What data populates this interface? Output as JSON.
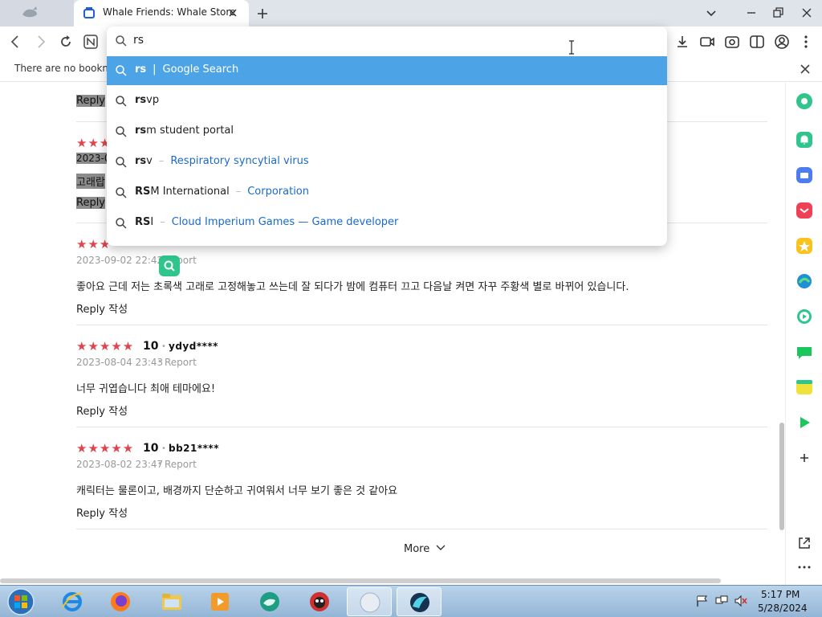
{
  "browser": {
    "tab_title": "Whale Friends: Whale Store",
    "bookmark_bar_text": "There are no bookma",
    "omnibox_query": "rs",
    "suggestions": [
      {
        "match": "rs",
        "rest": "",
        "sep": "|",
        "desc": "Google Search",
        "selected": true
      },
      {
        "match": "rs",
        "rest": "vp",
        "sep": "",
        "desc": "",
        "selected": false
      },
      {
        "match": "rs",
        "rest": "m student portal",
        "sep": "",
        "desc": "",
        "selected": false
      },
      {
        "match": "rs",
        "rest": "v",
        "sep": "–",
        "desc": "Respiratory syncytial virus",
        "selected": false
      },
      {
        "match": "RS",
        "rest": "M International",
        "sep": "–",
        "desc": "Corporation",
        "selected": false
      },
      {
        "match": "RS",
        "rest": "I",
        "sep": "–",
        "desc": "Cloud Imperium Games — Game developer",
        "selected": false
      }
    ]
  },
  "page": {
    "partial_review_1": {
      "reply": "Reply"
    },
    "partial_review_2": {
      "stars": "★★★",
      "date": "2023-0",
      "body": "고래랍",
      "reply": "Reply"
    },
    "partial_review_3": {
      "stars": "★★★",
      "date": "2023-09-02 22:42",
      "report": "Report",
      "body": "좋아요 근데 저는 초록색 고래로 고정해놓고 쓰는데 잘 되다가 밤에 컴퓨터 끄고 다음날 켜면 자꾸 주황색 별로 바뀌어 있습니다.",
      "reply": "Reply 작성"
    },
    "reviews": [
      {
        "stars": "★★★★★",
        "score": "10",
        "user": "ydyd****",
        "date": "2023-08-04 23:43",
        "report": "Report",
        "body": "너무 귀엽습니다 최애 테마에요!",
        "reply": "Reply 작성"
      },
      {
        "stars": "★★★★★",
        "score": "10",
        "user": "bb21****",
        "date": "2023-08-02 23:47",
        "report": "Report",
        "body": "캐릭터는 물론이고, 배경까지 단순하고 귀여워서 너무 보기 좋은 것 같아요",
        "reply": "Reply 작성"
      }
    ],
    "more_label": "More"
  },
  "taskbar": {
    "time": "5:17 PM",
    "date": "5/28/2024"
  },
  "colors": {
    "accent": "#4ca3e6",
    "star": "#e0444d",
    "link": "#1a6ac9",
    "whale_green": "#2fc58d"
  }
}
